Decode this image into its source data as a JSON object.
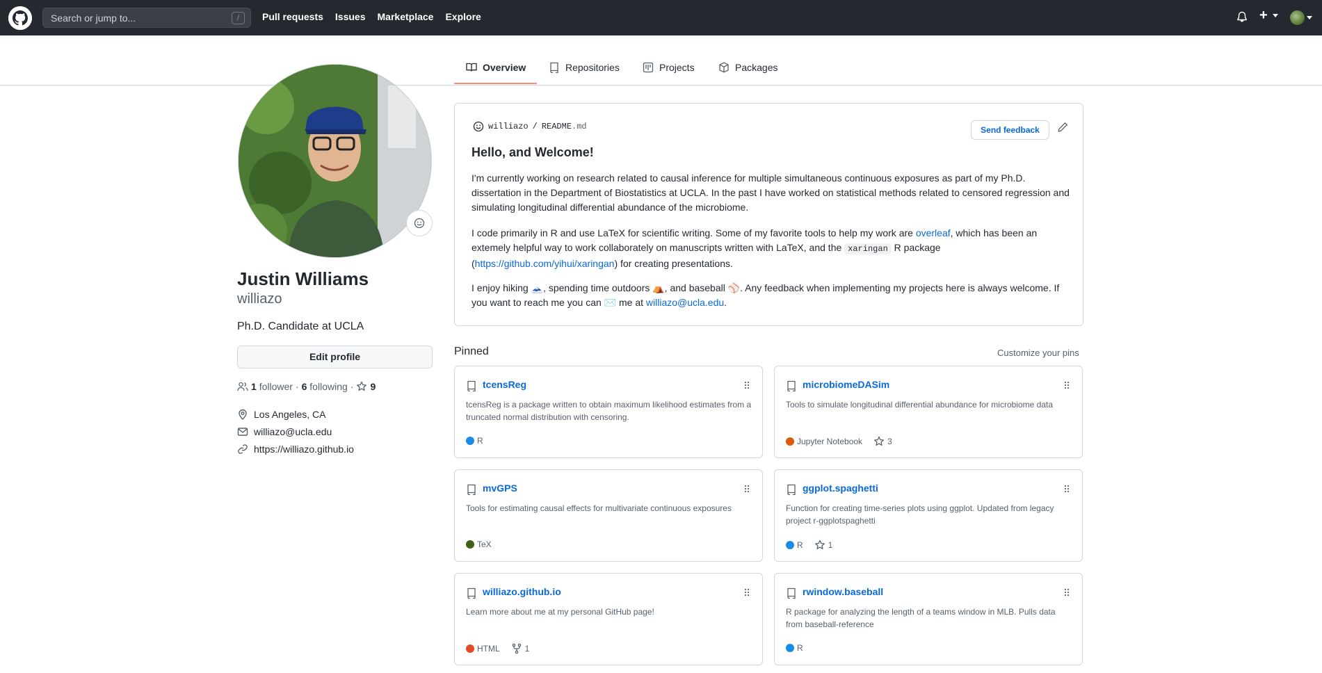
{
  "header": {
    "search_placeholder": "Search or jump to...",
    "search_shortcut": "/",
    "nav": [
      "Pull requests",
      "Issues",
      "Marketplace",
      "Explore"
    ]
  },
  "tabs": [
    {
      "label": "Overview",
      "icon": "book-icon",
      "active": true
    },
    {
      "label": "Repositories",
      "icon": "repo-icon",
      "active": false
    },
    {
      "label": "Projects",
      "icon": "project-icon",
      "active": false
    },
    {
      "label": "Packages",
      "icon": "package-icon",
      "active": false
    }
  ],
  "profile": {
    "name": "Justin Williams",
    "login": "williazo",
    "bio": "Ph.D. Candidate at UCLA",
    "edit_label": "Edit profile",
    "followers_count": "1",
    "followers_label": "follower",
    "following_count": "6",
    "following_label": "following",
    "stars_count": "9",
    "location": "Los Angeles, CA",
    "email": "williazo@ucla.edu",
    "website": "https://williazo.github.io"
  },
  "readme": {
    "owner": "williazo",
    "separator": "/",
    "file": "README",
    "ext": ".md",
    "feedback_label": "Send feedback",
    "heading": "Hello, and Welcome!",
    "p1": "I'm currently working on research related to causal inference for multiple simultaneous continuous exposures as part of my Ph.D. dissertation in the Department of Biostatistics at UCLA. In the past I have worked on statistical methods related to censored regression and simulating longitudinal differential abundance of the microbiome.",
    "p2_a": "I code primarily in R and use LaTeX for scientific writing. Some of my favorite tools to help my work are ",
    "p2_link1": "overleaf",
    "p2_b": ", which has been an extemely helpful way to work collaborately on manuscripts written with LaTeX, and the ",
    "p2_code": "xaringan",
    "p2_c": " R package (",
    "p2_link2": "https://github.com/yihui/xaringan",
    "p2_d": ") for creating presentations.",
    "p3_a": "I enjoy hiking 🗻, spending time outdoors ⛺, and baseball ⚾. Any feedback when implementing my projects here is always welcome. If you want to reach me you can ✉️ me at ",
    "p3_link": "williazo@ucla.edu",
    "p3_b": "."
  },
  "pinned": {
    "title": "Pinned",
    "customize": "Customize your pins",
    "repos": [
      {
        "name": "tcensReg",
        "desc": "tcensReg is a package written to obtain maximum likelihood estimates from a truncated normal distribution with censoring.",
        "lang": "R",
        "lang_color": "#198ce7",
        "stars": "",
        "forks": ""
      },
      {
        "name": "microbiomeDASim",
        "desc": "Tools to simulate longitudinal differential abundance for microbiome data",
        "lang": "Jupyter Notebook",
        "lang_color": "#da5b0b",
        "stars": "3",
        "forks": ""
      },
      {
        "name": "mvGPS",
        "desc": "Tools for estimating causal effects for multivariate continuous exposures",
        "lang": "TeX",
        "lang_color": "#3d6117",
        "stars": "",
        "forks": ""
      },
      {
        "name": "ggplot.spaghetti",
        "desc": "Function for creating time-series plots using ggplot. Updated from legacy project r-ggplotspaghetti",
        "lang": "R",
        "lang_color": "#198ce7",
        "stars": "1",
        "forks": ""
      },
      {
        "name": "williazo.github.io",
        "desc": "Learn more about me at my personal GitHub page!",
        "lang": "HTML",
        "lang_color": "#e34c26",
        "stars": "",
        "forks": "1"
      },
      {
        "name": "rwindow.baseball",
        "desc": "R package for analyzing the length of a teams window in MLB. Pulls data from baseball-reference",
        "lang": "R",
        "lang_color": "#198ce7",
        "stars": "",
        "forks": ""
      }
    ]
  }
}
